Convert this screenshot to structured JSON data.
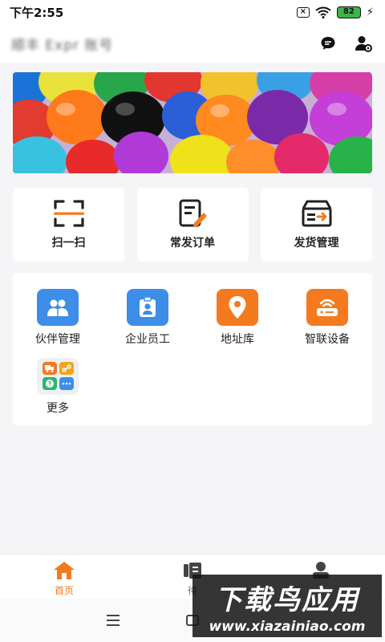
{
  "status_bar": {
    "time": "下午2:55",
    "battery": "82",
    "bolt": "⚡"
  },
  "header": {
    "user_name": "顺丰 Expr 账号"
  },
  "quick_actions": [
    {
      "label": "扫一扫",
      "icon": "scan-icon"
    },
    {
      "label": "常发订单",
      "icon": "order-edit-icon"
    },
    {
      "label": "发货管理",
      "icon": "shipping-box-icon"
    }
  ],
  "grid": [
    {
      "label": "伙伴管理",
      "icon": "partners-icon",
      "color": "#3d8ee8"
    },
    {
      "label": "企业员工",
      "icon": "employee-badge-icon",
      "color": "#3d8ee8"
    },
    {
      "label": "地址库",
      "icon": "location-pin-icon",
      "color": "#f47a20"
    },
    {
      "label": "智联设备",
      "icon": "router-device-icon",
      "color": "#f47a20"
    },
    {
      "label": "更多",
      "icon": "more-apps-icon"
    }
  ],
  "bottom_nav": [
    {
      "label": "首页",
      "icon": "home-icon",
      "active": true
    },
    {
      "label": "待",
      "icon": "tasks-icon",
      "active": false
    },
    {
      "label": "",
      "icon": "profile-icon",
      "active": false
    }
  ],
  "watermark": {
    "title": "下载鸟应用",
    "url": "www.xiazainiao.com"
  },
  "colors": {
    "accent": "#f47a20",
    "blue": "#3d8ee8",
    "background": "#f5f5f7"
  }
}
